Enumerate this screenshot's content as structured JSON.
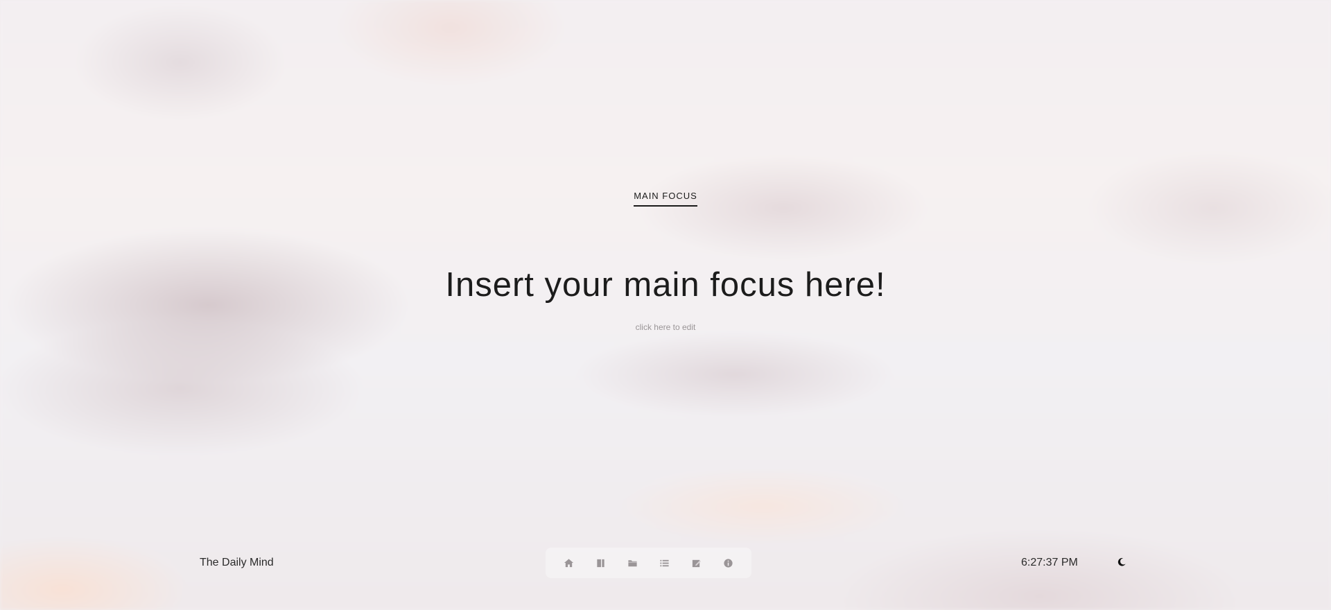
{
  "focus": {
    "label": "MAIN FOCUS",
    "text": "Insert your main focus here!",
    "hint": "click here to edit"
  },
  "footer": {
    "brand": "The Daily Mind",
    "time": "6:27:37 PM",
    "nav_items": [
      {
        "icon": "home-icon"
      },
      {
        "icon": "book-icon"
      },
      {
        "icon": "folder-icon"
      },
      {
        "icon": "list-icon"
      },
      {
        "icon": "edit-note-icon"
      },
      {
        "icon": "info-icon"
      }
    ],
    "theme_icon": "moon-icon"
  },
  "colors": {
    "text": "#1a1a1a",
    "hint": "#9a9597",
    "icon": "#9a9597"
  }
}
